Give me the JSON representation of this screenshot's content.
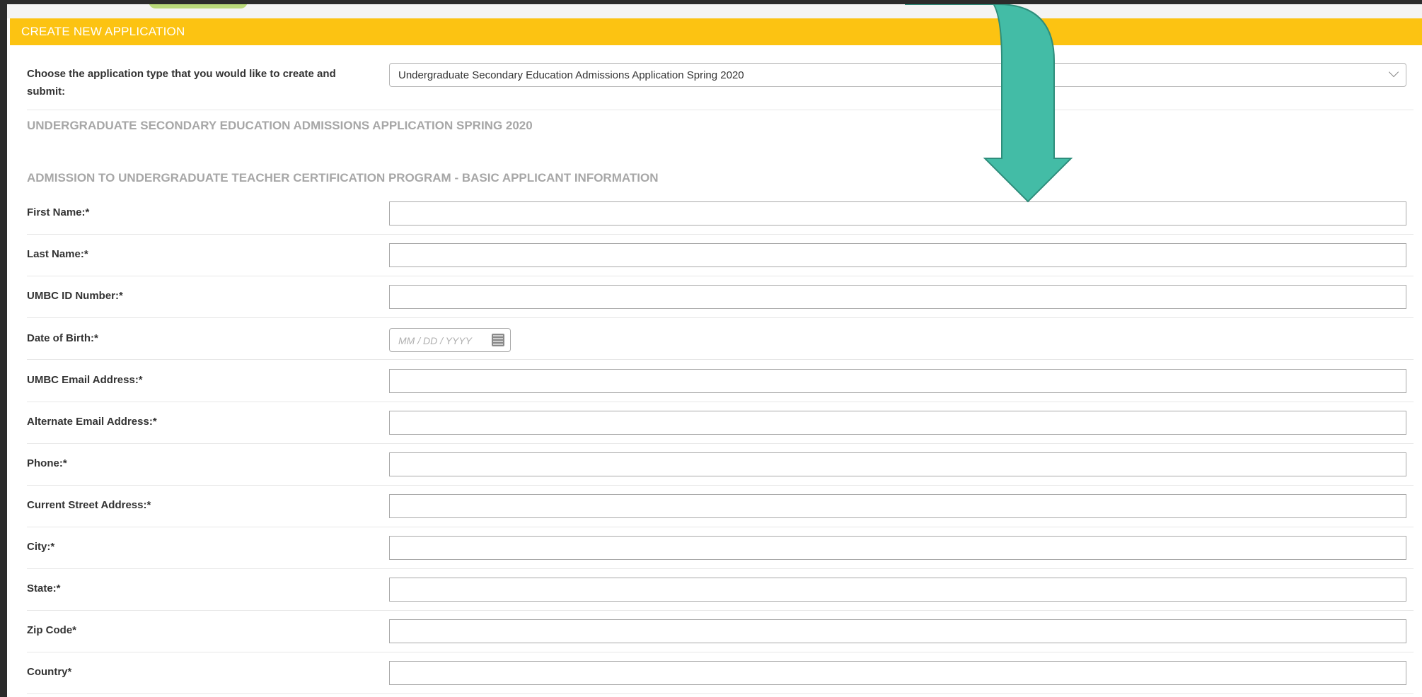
{
  "header": {
    "title": "CREATE NEW APPLICATION"
  },
  "application_type": {
    "label": "Choose the application type that you would like to create and submit:",
    "selected": "Undergraduate Secondary Education Admissions Application Spring 2020"
  },
  "sections": {
    "application_title": "UNDERGRADUATE SECONDARY EDUCATION ADMISSIONS APPLICATION SPRING 2020",
    "basic_info_title": "ADMISSION TO UNDERGRADUATE TEACHER CERTIFICATION PROGRAM - BASIC APPLICANT INFORMATION"
  },
  "fields": {
    "first_name": {
      "label": "First Name:*",
      "value": ""
    },
    "last_name": {
      "label": "Last Name:*",
      "value": ""
    },
    "umbc_id": {
      "label": "UMBC ID Number:*",
      "value": ""
    },
    "dob": {
      "label": "Date of Birth:*",
      "placeholder": "MM / DD / YYYY"
    },
    "umbc_email": {
      "label": "UMBC Email Address:*",
      "value": ""
    },
    "alt_email": {
      "label": "Alternate Email Address:*",
      "value": ""
    },
    "phone": {
      "label": "Phone:*",
      "value": ""
    },
    "street": {
      "label": "Current Street Address:*",
      "value": ""
    },
    "city": {
      "label": "City:*",
      "value": ""
    },
    "state": {
      "label": "State:*",
      "value": ""
    },
    "zip": {
      "label": "Zip Code*",
      "value": ""
    },
    "country": {
      "label": "Country*",
      "value": ""
    }
  },
  "icons": {
    "dropdown": "chevron-down-icon",
    "calendar": "calendar-icon",
    "annotation": "arrow-down-icon"
  },
  "colors": {
    "header_bg": "#fcc312",
    "header_text": "#ffffff",
    "section_title": "#a7a7a7",
    "annotation_arrow": "#43bca6"
  }
}
